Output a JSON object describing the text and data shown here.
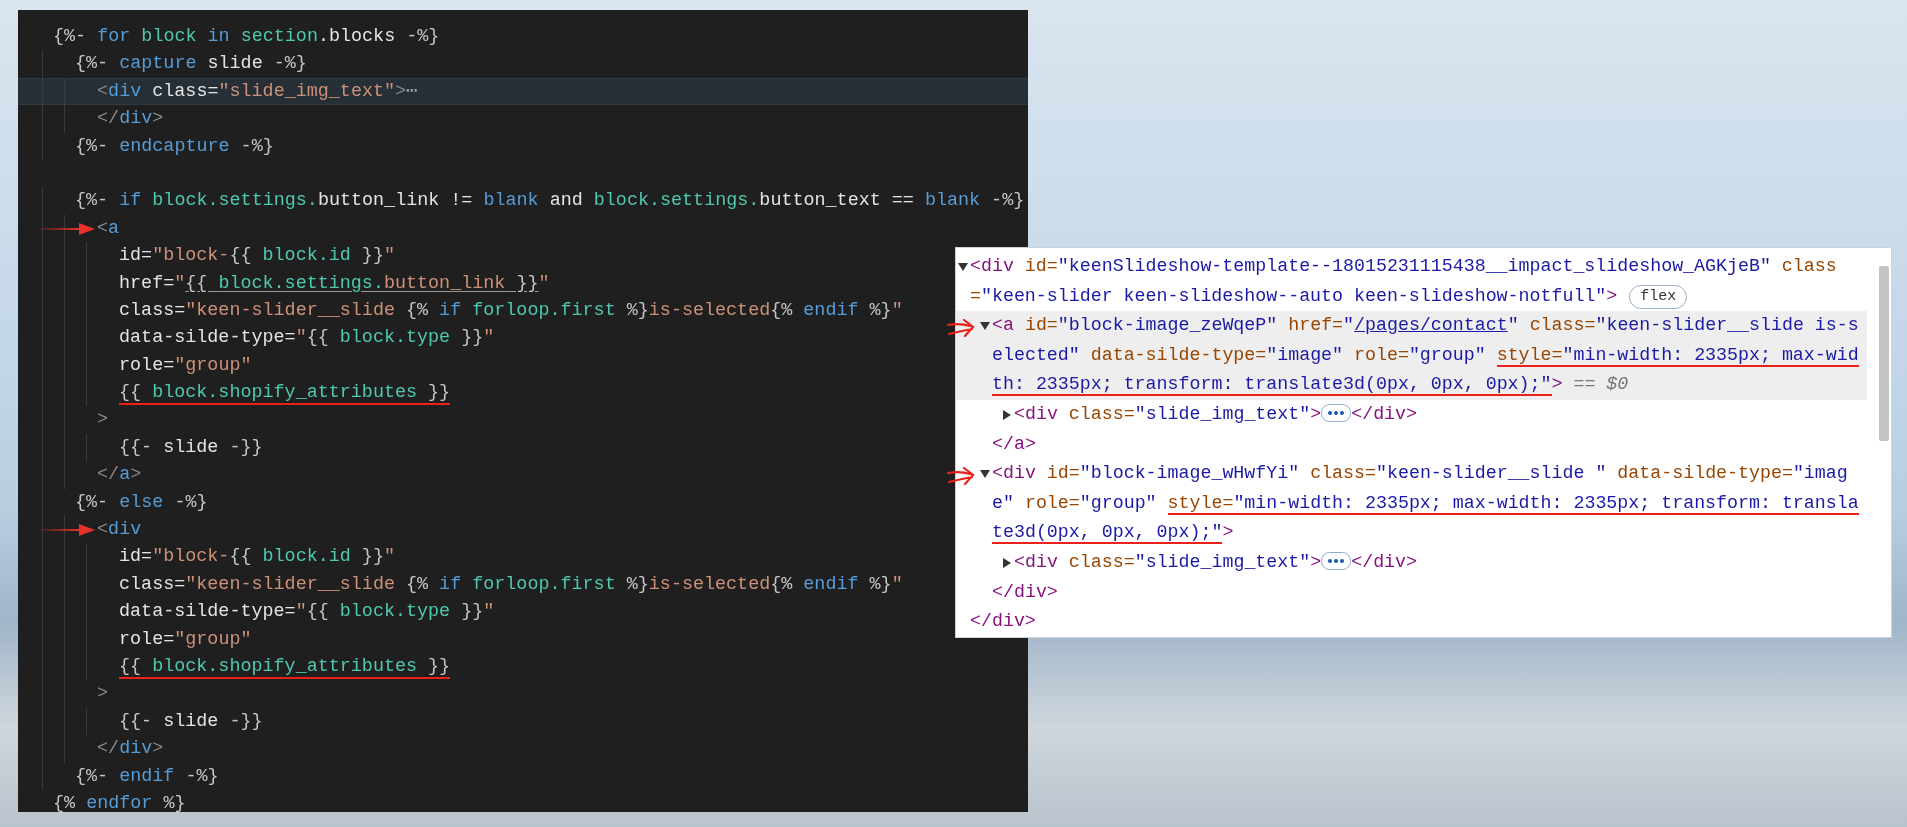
{
  "editor": {
    "lines": [
      {
        "kind": "code",
        "tokens": [
          {
            "kind": "delim",
            "text": "{%- "
          },
          {
            "kind": "kw",
            "text": "for"
          },
          {
            "kind": "obj",
            "text": " block"
          },
          {
            "kind": "kw",
            "text": " in"
          },
          {
            "kind": "obj",
            "text": " section"
          },
          {
            "kind": "plain",
            "text": ".blocks"
          },
          {
            "kind": "delim",
            "text": " -%}"
          }
        ],
        "children": [
          {
            "kind": "code",
            "tokens": [
              {
                "kind": "delim",
                "text": "{%- "
              },
              {
                "kind": "kw",
                "text": "capture"
              },
              {
                "kind": "plain",
                "text": " slide"
              },
              {
                "kind": "delim",
                "text": " -%}"
              }
            ],
            "children": [
              {
                "kind": "code",
                "current": true,
                "tokens": [
                  {
                    "kind": "tag",
                    "text": "<"
                  },
                  {
                    "kind": "kw",
                    "text": "div"
                  },
                  {
                    "kind": "plain",
                    "text": " class="
                  },
                  {
                    "kind": "str",
                    "text": "\"slide_img_text\""
                  },
                  {
                    "kind": "tag",
                    "text": ">"
                  },
                  {
                    "kind": "fold",
                    "text": "⋯"
                  }
                ]
              },
              {
                "kind": "code",
                "tokens": [
                  {
                    "kind": "tag",
                    "text": "</"
                  },
                  {
                    "kind": "kw",
                    "text": "div"
                  },
                  {
                    "kind": "tag",
                    "text": ">"
                  }
                ]
              }
            ]
          },
          {
            "kind": "code",
            "tokens": [
              {
                "kind": "delim",
                "text": "{%- "
              },
              {
                "kind": "kw",
                "text": "endcapture"
              },
              {
                "kind": "delim",
                "text": " -%}"
              }
            ]
          },
          {
            "kind": "blank"
          },
          {
            "kind": "code",
            "tokens": [
              {
                "kind": "delim",
                "text": "{%- "
              },
              {
                "kind": "kw",
                "text": "if"
              },
              {
                "kind": "obj",
                "text": " block.settings."
              },
              {
                "kind": "plain",
                "text": "button_link != "
              },
              {
                "kind": "kw",
                "text": "blank"
              },
              {
                "kind": "plain",
                "text": " and "
              },
              {
                "kind": "obj",
                "text": "block.settings."
              },
              {
                "kind": "plain",
                "text": "button_text == "
              },
              {
                "kind": "kw",
                "text": "blank"
              },
              {
                "kind": "delim",
                "text": " -%}"
              }
            ],
            "children": [
              {
                "kind": "code",
                "annotated": true,
                "tokens": [
                  {
                    "kind": "tag",
                    "text": "<"
                  },
                  {
                    "kind": "kw",
                    "text": "a"
                  }
                ],
                "children": [
                  {
                    "kind": "code",
                    "tokens": [
                      {
                        "kind": "plain",
                        "text": "id="
                      },
                      {
                        "kind": "str",
                        "text": "\"block-"
                      },
                      {
                        "kind": "delim",
                        "text": "{{ "
                      },
                      {
                        "kind": "obj",
                        "text": "block.id"
                      },
                      {
                        "kind": "delim",
                        "text": " }}"
                      },
                      {
                        "kind": "str",
                        "text": "\""
                      }
                    ]
                  },
                  {
                    "kind": "code",
                    "tokens": [
                      {
                        "kind": "plain",
                        "text": "href="
                      },
                      {
                        "kind": "str",
                        "text": "\""
                      },
                      {
                        "kind": "delim",
                        "text": "{{ ",
                        "link": true
                      },
                      {
                        "kind": "obj",
                        "text": "block.settings.",
                        "link": true
                      },
                      {
                        "kind": "str",
                        "text": "button_link",
                        "link": true
                      },
                      {
                        "kind": "delim",
                        "text": " }}",
                        "link": true
                      },
                      {
                        "kind": "str",
                        "text": "\""
                      }
                    ]
                  },
                  {
                    "kind": "code",
                    "tokens": [
                      {
                        "kind": "plain",
                        "text": "class="
                      },
                      {
                        "kind": "str",
                        "text": "\"keen-slider__slide "
                      },
                      {
                        "kind": "delim",
                        "text": "{% "
                      },
                      {
                        "kind": "kw",
                        "text": "if"
                      },
                      {
                        "kind": "obj",
                        "text": " forloop.first"
                      },
                      {
                        "kind": "delim",
                        "text": " %}"
                      },
                      {
                        "kind": "str",
                        "text": "is-selected"
                      },
                      {
                        "kind": "delim",
                        "text": "{% "
                      },
                      {
                        "kind": "kw",
                        "text": "endif"
                      },
                      {
                        "kind": "delim",
                        "text": " %}"
                      },
                      {
                        "kind": "str",
                        "text": "\""
                      }
                    ]
                  },
                  {
                    "kind": "code",
                    "tokens": [
                      {
                        "kind": "plain",
                        "text": "data-silde-type="
                      },
                      {
                        "kind": "str",
                        "text": "\""
                      },
                      {
                        "kind": "delim",
                        "text": "{{ "
                      },
                      {
                        "kind": "obj",
                        "text": "block.type"
                      },
                      {
                        "kind": "delim",
                        "text": " }}"
                      },
                      {
                        "kind": "str",
                        "text": "\""
                      }
                    ]
                  },
                  {
                    "kind": "code",
                    "tokens": [
                      {
                        "kind": "plain",
                        "text": "role="
                      },
                      {
                        "kind": "str",
                        "text": "\"group\""
                      }
                    ]
                  },
                  {
                    "kind": "code",
                    "tokens": [
                      {
                        "kind": "delim",
                        "text": "{{ ",
                        "underlined": true
                      },
                      {
                        "kind": "obj",
                        "text": "block.shopify_attributes",
                        "underlined": true
                      },
                      {
                        "kind": "delim",
                        "text": " }}",
                        "underlined": true
                      }
                    ]
                  }
                ]
              },
              {
                "kind": "code",
                "tokens": [
                  {
                    "kind": "tag",
                    "text": ">"
                  }
                ],
                "children": [
                  {
                    "kind": "code",
                    "tokens": [
                      {
                        "kind": "delim",
                        "text": "{{- "
                      },
                      {
                        "kind": "plain",
                        "text": "slide"
                      },
                      {
                        "kind": "delim",
                        "text": " -}}"
                      }
                    ]
                  }
                ]
              },
              {
                "kind": "code",
                "tokens": [
                  {
                    "kind": "tag",
                    "text": "</"
                  },
                  {
                    "kind": "kw",
                    "text": "a"
                  },
                  {
                    "kind": "tag",
                    "text": ">"
                  }
                ]
              }
            ]
          },
          {
            "kind": "code",
            "tokens": [
              {
                "kind": "delim",
                "text": "{%- "
              },
              {
                "kind": "kw",
                "text": "else"
              },
              {
                "kind": "delim",
                "text": " -%}"
              }
            ],
            "children": [
              {
                "kind": "code",
                "annotated": true,
                "tokens": [
                  {
                    "kind": "tag",
                    "text": "<"
                  },
                  {
                    "kind": "kw",
                    "text": "div"
                  }
                ],
                "children": [
                  {
                    "kind": "code",
                    "tokens": [
                      {
                        "kind": "plain",
                        "text": "id="
                      },
                      {
                        "kind": "str",
                        "text": "\"block-"
                      },
                      {
                        "kind": "delim",
                        "text": "{{ "
                      },
                      {
                        "kind": "obj",
                        "text": "block.id"
                      },
                      {
                        "kind": "delim",
                        "text": " }}"
                      },
                      {
                        "kind": "str",
                        "text": "\""
                      }
                    ]
                  },
                  {
                    "kind": "code",
                    "tokens": [
                      {
                        "kind": "plain",
                        "text": "class="
                      },
                      {
                        "kind": "str",
                        "text": "\"keen-slider__slide "
                      },
                      {
                        "kind": "delim",
                        "text": "{% "
                      },
                      {
                        "kind": "kw",
                        "text": "if"
                      },
                      {
                        "kind": "obj",
                        "text": " forloop.first"
                      },
                      {
                        "kind": "delim",
                        "text": " %}"
                      },
                      {
                        "kind": "str",
                        "text": "is-selected"
                      },
                      {
                        "kind": "delim",
                        "text": "{% "
                      },
                      {
                        "kind": "kw",
                        "text": "endif"
                      },
                      {
                        "kind": "delim",
                        "text": " %}"
                      },
                      {
                        "kind": "str",
                        "text": "\""
                      }
                    ]
                  },
                  {
                    "kind": "code",
                    "tokens": [
                      {
                        "kind": "plain",
                        "text": "data-silde-type="
                      },
                      {
                        "kind": "str",
                        "text": "\""
                      },
                      {
                        "kind": "delim",
                        "text": "{{ "
                      },
                      {
                        "kind": "obj",
                        "text": "block.type"
                      },
                      {
                        "kind": "delim",
                        "text": " }}"
                      },
                      {
                        "kind": "str",
                        "text": "\""
                      }
                    ]
                  },
                  {
                    "kind": "code",
                    "tokens": [
                      {
                        "kind": "plain",
                        "text": "role="
                      },
                      {
                        "kind": "str",
                        "text": "\"group\""
                      }
                    ]
                  },
                  {
                    "kind": "code",
                    "tokens": [
                      {
                        "kind": "delim",
                        "text": "{{ ",
                        "underlined": true
                      },
                      {
                        "kind": "obj",
                        "text": "block.shopify_attributes",
                        "underlined": true
                      },
                      {
                        "kind": "delim",
                        "text": " }}",
                        "underlined": true
                      }
                    ]
                  }
                ]
              },
              {
                "kind": "code",
                "tokens": [
                  {
                    "kind": "tag",
                    "text": ">"
                  }
                ],
                "children": [
                  {
                    "kind": "code",
                    "tokens": [
                      {
                        "kind": "delim",
                        "text": "{{- "
                      },
                      {
                        "kind": "plain",
                        "text": "slide"
                      },
                      {
                        "kind": "delim",
                        "text": " -}}"
                      }
                    ]
                  }
                ]
              },
              {
                "kind": "code",
                "tokens": [
                  {
                    "kind": "tag",
                    "text": "</"
                  },
                  {
                    "kind": "kw",
                    "text": "div"
                  },
                  {
                    "kind": "tag",
                    "text": ">"
                  }
                ]
              }
            ]
          },
          {
            "kind": "code",
            "tokens": [
              {
                "kind": "delim",
                "text": "{%- "
              },
              {
                "kind": "kw",
                "text": "endif"
              },
              {
                "kind": "delim",
                "text": " -%}"
              }
            ]
          }
        ]
      },
      {
        "kind": "code",
        "tokens": [
          {
            "kind": "delim",
            "text": "{% "
          },
          {
            "kind": "kw",
            "text": "endfor"
          },
          {
            "kind": "delim",
            "text": " %}"
          }
        ]
      }
    ]
  },
  "devtools": {
    "nodes": [
      {
        "expanded": true,
        "tokens": [
          {
            "kind": "tag",
            "text": "<div"
          },
          {
            "kind": "attr",
            "text": " id="
          },
          {
            "kind": "val",
            "text": "\"keenSlideshow-template--18015231115438__impact_slideshow_AGKjeB\""
          },
          {
            "kind": "attr",
            "text": " class="
          },
          {
            "kind": "val",
            "text": "\"keen-slider keen-slideshow--auto keen-slideshow-notfull\""
          },
          {
            "kind": "tag",
            "text": ">"
          },
          {
            "kind": "badge",
            "text": "flex"
          }
        ],
        "children": [
          {
            "expanded": true,
            "selected": true,
            "annotated": true,
            "tokens": [
              {
                "kind": "tag",
                "text": "<a"
              },
              {
                "kind": "attr",
                "text": " id="
              },
              {
                "kind": "val",
                "text": "\"block-image_zeWqeP\""
              },
              {
                "kind": "attr",
                "text": " href="
              },
              {
                "kind": "val",
                "text": "\""
              },
              {
                "kind": "link",
                "text": "/pages/contact"
              },
              {
                "kind": "val",
                "text": "\""
              },
              {
                "kind": "attr",
                "text": " class="
              },
              {
                "kind": "val",
                "text": "\"keen-slider__slide is-selected\""
              },
              {
                "kind": "attr",
                "text": " data-silde-type="
              },
              {
                "kind": "val",
                "text": "\"image\""
              },
              {
                "kind": "attr",
                "text": " role="
              },
              {
                "kind": "val",
                "text": "\"group\" "
              },
              {
                "kind": "attr",
                "text": "style=",
                "underlined": true
              },
              {
                "kind": "val",
                "text": "\"min-width: 2335px; max-width: 2335px; transform: translate3d(0px, 0px, 0px);\"",
                "underlined": true
              },
              {
                "kind": "tag",
                "text": ">"
              },
              {
                "kind": "ref",
                "text": " == $0"
              }
            ],
            "children": [
              {
                "expanded": false,
                "selected": false,
                "tokens": [
                  {
                    "kind": "tag",
                    "text": "<div"
                  },
                  {
                    "kind": "attr",
                    "text": " class="
                  },
                  {
                    "kind": "val",
                    "text": "\"slide_img_text\""
                  },
                  {
                    "kind": "tag",
                    "text": ">"
                  },
                  {
                    "kind": "ellipsis"
                  },
                  {
                    "kind": "tag",
                    "text": "</div>"
                  }
                ]
              }
            ]
          },
          {
            "selected": false,
            "tokens": [
              {
                "kind": "tag",
                "text": "</a>"
              }
            ]
          },
          {
            "expanded": true,
            "selected": false,
            "annotated": true,
            "tokens": [
              {
                "kind": "tag",
                "text": "<div"
              },
              {
                "kind": "attr",
                "text": " id="
              },
              {
                "kind": "val",
                "text": "\"block-image_wHwfYi\""
              },
              {
                "kind": "attr",
                "text": " class="
              },
              {
                "kind": "val",
                "text": "\"keen-slider__slide \""
              },
              {
                "kind": "attr",
                "text": " data-silde-type="
              },
              {
                "kind": "val",
                "text": "\"image\""
              },
              {
                "kind": "attr",
                "text": " role="
              },
              {
                "kind": "val",
                "text": "\"group\" "
              },
              {
                "kind": "attr",
                "text": "style=",
                "underlined": true
              },
              {
                "kind": "val",
                "text": "\"min-width: 2335px; max-width: 2335px; transform: translate3d(0px, 0px, 0px);\"",
                "underlined": true
              },
              {
                "kind": "tag",
                "text": ">"
              }
            ],
            "children": [
              {
                "expanded": false,
                "selected": false,
                "tokens": [
                  {
                    "kind": "tag",
                    "text": "<div"
                  },
                  {
                    "kind": "attr",
                    "text": " class="
                  },
                  {
                    "kind": "val",
                    "text": "\"slide_img_text\""
                  },
                  {
                    "kind": "tag",
                    "text": ">"
                  },
                  {
                    "kind": "ellipsis"
                  },
                  {
                    "kind": "tag",
                    "text": "</div>"
                  }
                ]
              }
            ]
          },
          {
            "selected": false,
            "tokens": [
              {
                "kind": "tag",
                "text": "</div>"
              }
            ]
          }
        ]
      },
      {
        "selected": false,
        "tokens": [
          {
            "kind": "tag",
            "text": "</div>"
          }
        ]
      }
    ]
  }
}
